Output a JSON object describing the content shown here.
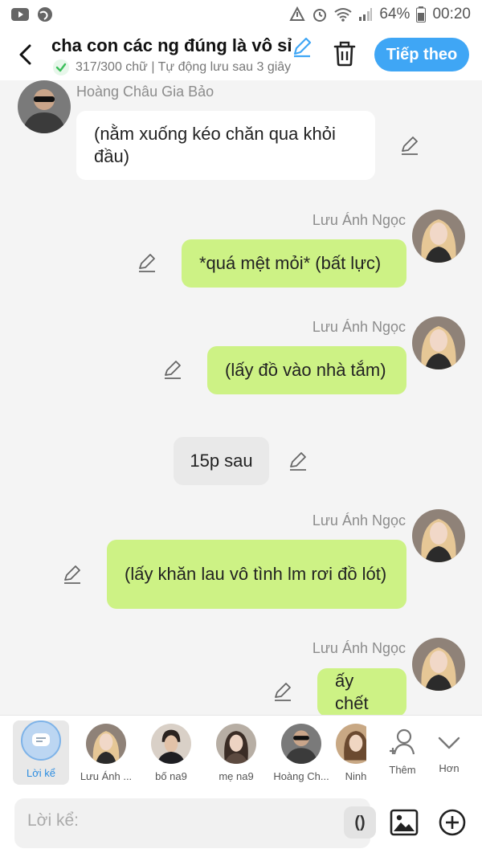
{
  "status_bar": {
    "battery": "64%",
    "time": "00:20",
    "icons": [
      "youtube-icon",
      "browser-icon",
      "data-saver-icon",
      "alarm-icon",
      "wifi-icon",
      "signal-icon",
      "battery-icon"
    ]
  },
  "header": {
    "title": "cha con các ng đúng là vô sỉ",
    "subtitle": "317/300 chữ | Tự động lưu sau 3 giây",
    "next_label": "Tiếp theo"
  },
  "messages": [
    {
      "type": "other",
      "author": "Hoàng Châu Gia Bảo",
      "text": "(nằm xuống kéo chăn qua khỏi đầu)"
    },
    {
      "type": "self",
      "author": "Lưu Ánh Ngọc",
      "text": "*quá mệt mỏi* (bất lực)"
    },
    {
      "type": "self",
      "author": "Lưu Ánh Ngọc",
      "text": "(lấy đồ vào nhà tắm)"
    },
    {
      "type": "narration",
      "text": "15p sau"
    },
    {
      "type": "self",
      "author": "Lưu Ánh Ngọc",
      "text": "(lấy khăn lau vô tình lm rơi đồ lót)"
    },
    {
      "type": "self",
      "author": "Lưu Ánh Ngọc",
      "text": "ấy chết"
    }
  ],
  "characters": [
    {
      "label": "Lời kể",
      "selected": true
    },
    {
      "label": "Lưu Ánh ..."
    },
    {
      "label": "bố na9"
    },
    {
      "label": "mẹ na9"
    },
    {
      "label": "Hoàng Ch..."
    },
    {
      "label": "Ninh"
    },
    {
      "label": "Thêm"
    },
    {
      "label": "Hơn"
    }
  ],
  "input": {
    "placeholder": "Lời kể:",
    "paren_label": "()"
  },
  "colors": {
    "accent": "#3fa6f5",
    "self_bubble": "#cdf285",
    "other_bubble": "#ffffff",
    "narration_bubble": "#e9e9e9",
    "background": "#f4f4f4"
  }
}
